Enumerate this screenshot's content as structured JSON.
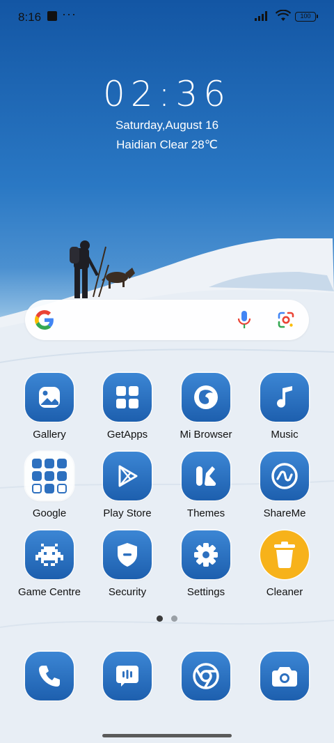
{
  "status_bar": {
    "time": "8:16",
    "dots": "···",
    "battery": "100"
  },
  "clock": {
    "time": "02:36",
    "date": "Saturday,August 16",
    "weather": "Haidian Clear 28℃"
  },
  "search": {
    "logo": "google-g-icon",
    "mic": "microphone-icon",
    "lens": "google-lens-icon"
  },
  "apps": [
    {
      "label": "Gallery",
      "icon": "gallery-icon"
    },
    {
      "label": "GetApps",
      "icon": "getapps-icon"
    },
    {
      "label": "Mi Browser",
      "icon": "mi-browser-icon"
    },
    {
      "label": "Music",
      "icon": "music-icon"
    },
    {
      "label": "Google",
      "icon": "google-folder-icon"
    },
    {
      "label": "Play Store",
      "icon": "play-store-icon"
    },
    {
      "label": "Themes",
      "icon": "themes-icon"
    },
    {
      "label": "ShareMe",
      "icon": "shareme-icon"
    },
    {
      "label": "Game Centre",
      "icon": "game-centre-icon"
    },
    {
      "label": "Security",
      "icon": "security-icon"
    },
    {
      "label": "Settings",
      "icon": "settings-icon"
    },
    {
      "label": "Cleaner",
      "icon": "cleaner-icon"
    }
  ],
  "dock": [
    {
      "icon": "phone-icon"
    },
    {
      "icon": "messages-icon"
    },
    {
      "icon": "chrome-icon"
    },
    {
      "icon": "camera-icon"
    }
  ],
  "pages": {
    "current": 1,
    "total": 2
  },
  "colors": {
    "icon_blue": "#1d5fae",
    "cleaner_yellow": "#f7b21a"
  }
}
